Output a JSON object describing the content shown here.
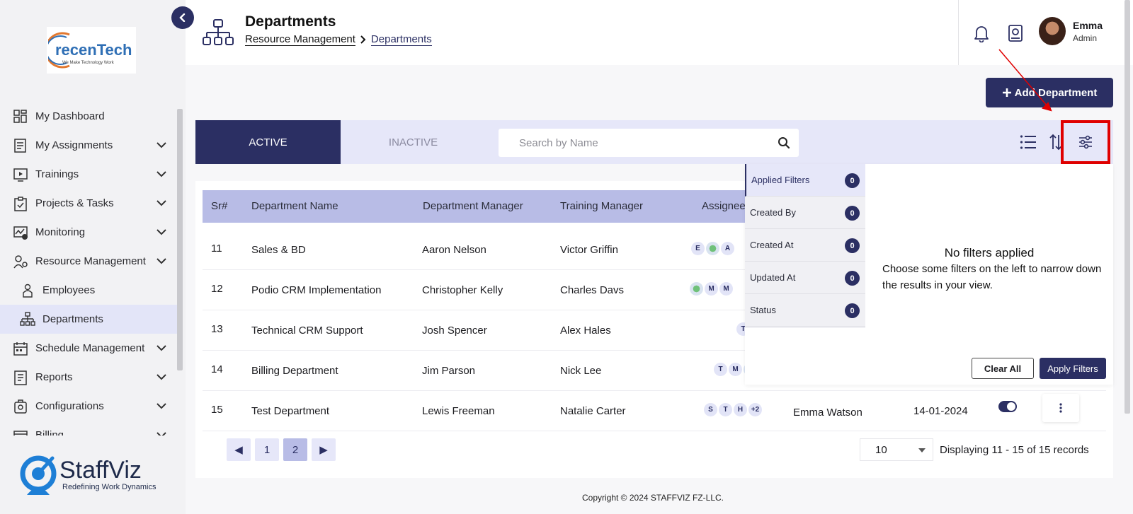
{
  "brand": {
    "logo_main": "recenTech",
    "logo_tagline": "We Make Technology Work",
    "bottom_logo_name": "StaffViz",
    "bottom_logo_tagline": "Redefining Work Dynamics"
  },
  "sidebar": {
    "items": [
      {
        "label": "My Dashboard",
        "icon": "dashboard-icon",
        "has_chevron": false
      },
      {
        "label": "My Assignments",
        "icon": "assignments-icon",
        "has_chevron": true
      },
      {
        "label": "Trainings",
        "icon": "trainings-icon",
        "has_chevron": true
      },
      {
        "label": "Projects & Tasks",
        "icon": "clipboard-icon",
        "has_chevron": true
      },
      {
        "label": "Monitoring",
        "icon": "monitoring-icon",
        "has_chevron": true
      },
      {
        "label": "Resource Management",
        "icon": "resource-icon",
        "has_chevron": true
      },
      {
        "label": "Employees",
        "icon": "employee-icon",
        "has_chevron": false,
        "sub": true
      },
      {
        "label": "Departments",
        "icon": "org-chart-icon",
        "has_chevron": false,
        "sub": true,
        "active": true
      },
      {
        "label": "Schedule Management",
        "icon": "calendar-icon",
        "has_chevron": true
      },
      {
        "label": "Reports",
        "icon": "report-icon",
        "has_chevron": true
      },
      {
        "label": "Configurations",
        "icon": "config-icon",
        "has_chevron": true
      },
      {
        "label": "Billing",
        "icon": "billing-icon",
        "has_chevron": true
      }
    ]
  },
  "header": {
    "title": "Departments",
    "breadcrumb": [
      "Resource Management",
      "Departments"
    ],
    "user_name": "Emma",
    "user_role": "Admin"
  },
  "toolbar": {
    "add_label": "Add Department"
  },
  "tabs": {
    "active": "ACTIVE",
    "inactive": "INACTIVE"
  },
  "search": {
    "placeholder": "Search by Name",
    "value": ""
  },
  "table": {
    "columns": [
      "Sr#",
      "Department Name",
      "Department Manager",
      "Training Manager",
      "Assignees"
    ],
    "rows": [
      {
        "sr": "11",
        "name": "Sales & BD",
        "manager": "Aaron Nelson",
        "trainer": "Victor Griffin",
        "chips": [
          "E",
          "img",
          "A"
        ],
        "extra_name": "",
        "date": ""
      },
      {
        "sr": "12",
        "name": "Podio CRM Implementation",
        "manager": "Christopher Kelly",
        "trainer": "Charles Davs",
        "chips": [
          "img",
          "M",
          "M"
        ],
        "extra_name": "",
        "date": ""
      },
      {
        "sr": "13",
        "name": "Technical CRM Support",
        "manager": "Josh Spencer",
        "trainer": "Alex Hales",
        "chips": [
          "T"
        ],
        "extra_name": "",
        "date": ""
      },
      {
        "sr": "14",
        "name": "Billing Department",
        "manager": "Jim Parson",
        "trainer": "Nick Lee",
        "chips": [
          "T",
          "M",
          "img"
        ],
        "extra_name": "",
        "date": ""
      },
      {
        "sr": "15",
        "name": "Test Department",
        "manager": "Lewis Freeman",
        "trainer": "Natalie Carter",
        "chips": [
          "S",
          "T",
          "H",
          "+2"
        ],
        "extra_name": "Emma Watson",
        "date": "14-01-2024",
        "status_on": true
      }
    ]
  },
  "pagination": {
    "prev": "◀",
    "pages": [
      "1",
      "2"
    ],
    "current": "2",
    "next": "▶",
    "per_page": "10",
    "records": "Displaying 11 - 15 of 15 records"
  },
  "filters": {
    "items": [
      {
        "label": "Applied Filters",
        "count": "0",
        "selected": true
      },
      {
        "label": "Created By",
        "count": "0"
      },
      {
        "label": "Created At",
        "count": "0"
      },
      {
        "label": "Updated At",
        "count": "0"
      },
      {
        "label": "Status",
        "count": "0"
      }
    ],
    "empty_title": "No filters applied",
    "empty_text": "Choose some filters on the left to narrow down the results in your view.",
    "clear_label": "Clear All",
    "apply_label": "Apply Filters"
  },
  "footer": {
    "copyright": "Copyright © 2024 STAFFVIZ FZ-LLC."
  },
  "colors": {
    "primary": "#2b2f63",
    "accent_light": "#e6e7f9",
    "header_row": "#b8bce6",
    "highlight": "#e00000"
  }
}
